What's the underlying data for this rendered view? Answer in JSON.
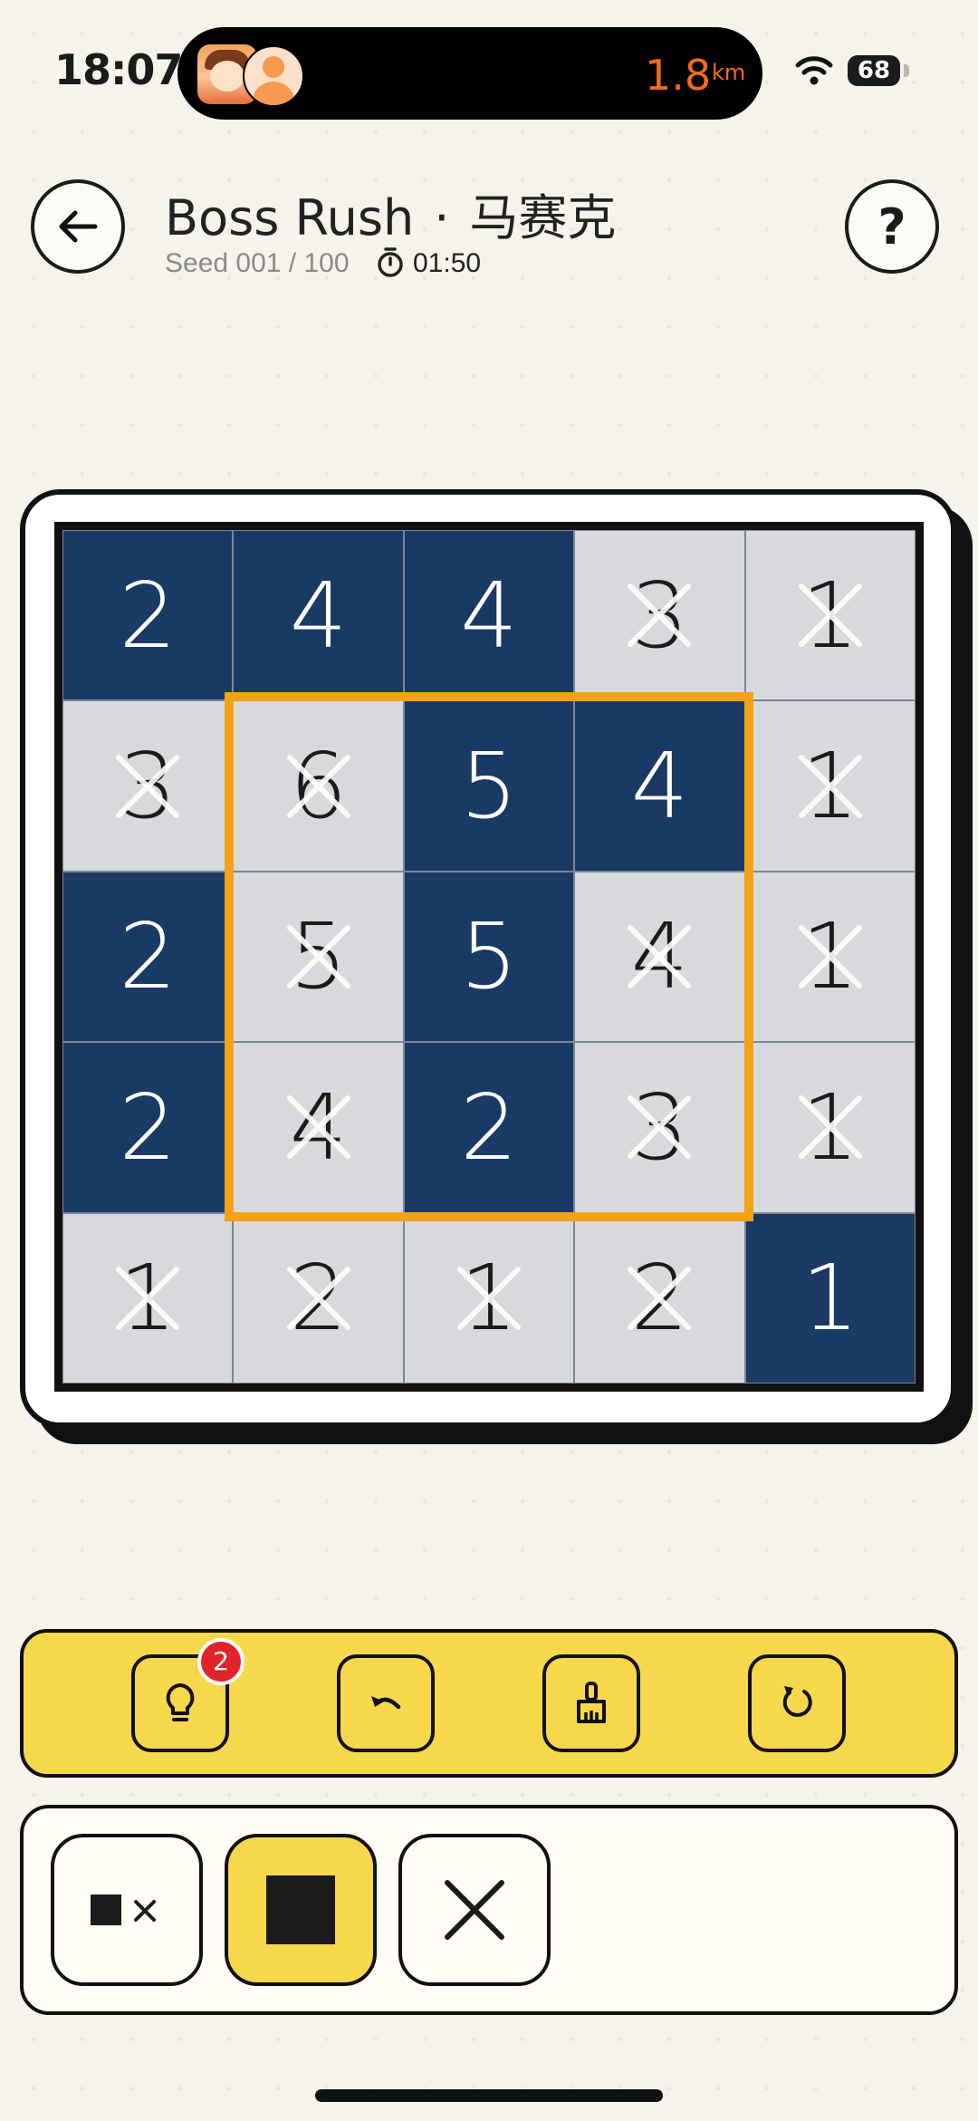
{
  "status_bar": {
    "time": "18:07",
    "distance_value": "1.8",
    "distance_unit": "km",
    "battery": "68"
  },
  "header": {
    "title_en": "Boss Rush",
    "title_separator": "·",
    "title_cn": "马赛克",
    "seed": "Seed 001 / 100",
    "timer": "01:50"
  },
  "board": {
    "rows": [
      [
        {
          "n": "2",
          "s": "filled"
        },
        {
          "n": "4",
          "s": "filled"
        },
        {
          "n": "4",
          "s": "filled"
        },
        {
          "n": "3",
          "s": "crossed"
        },
        {
          "n": "1",
          "s": "crossed"
        }
      ],
      [
        {
          "n": "3",
          "s": "crossed"
        },
        {
          "n": "6",
          "s": "crossed"
        },
        {
          "n": "5",
          "s": "filled"
        },
        {
          "n": "4",
          "s": "filled"
        },
        {
          "n": "1",
          "s": "crossed"
        }
      ],
      [
        {
          "n": "2",
          "s": "filled"
        },
        {
          "n": "5",
          "s": "crossed"
        },
        {
          "n": "5",
          "s": "filled"
        },
        {
          "n": "4",
          "s": "crossed"
        },
        {
          "n": "1",
          "s": "crossed"
        }
      ],
      [
        {
          "n": "2",
          "s": "filled"
        },
        {
          "n": "4",
          "s": "crossed"
        },
        {
          "n": "2",
          "s": "filled"
        },
        {
          "n": "3",
          "s": "crossed"
        },
        {
          "n": "1",
          "s": "crossed"
        }
      ],
      [
        {
          "n": "1",
          "s": "crossed"
        },
        {
          "n": "2",
          "s": "crossed"
        },
        {
          "n": "1",
          "s": "crossed"
        },
        {
          "n": "2",
          "s": "crossed"
        },
        {
          "n": "1",
          "s": "filled"
        }
      ]
    ],
    "highlight_region": {
      "row_start": 1,
      "col_start": 1,
      "rows": 3,
      "cols": 3
    },
    "colors": {
      "filled": "#1a3a66",
      "crossed": "#d8d9dc",
      "highlight": "#f3a117"
    }
  },
  "toolbar": {
    "hint_count": "2",
    "tools": [
      "hint-icon",
      "undo-icon",
      "clear-icon",
      "restart-icon"
    ],
    "accent": "#f7d84c"
  },
  "modes": {
    "items": [
      "fill-and-cross-mode",
      "fill-mode",
      "cross-mode"
    ],
    "active": "fill-mode"
  }
}
